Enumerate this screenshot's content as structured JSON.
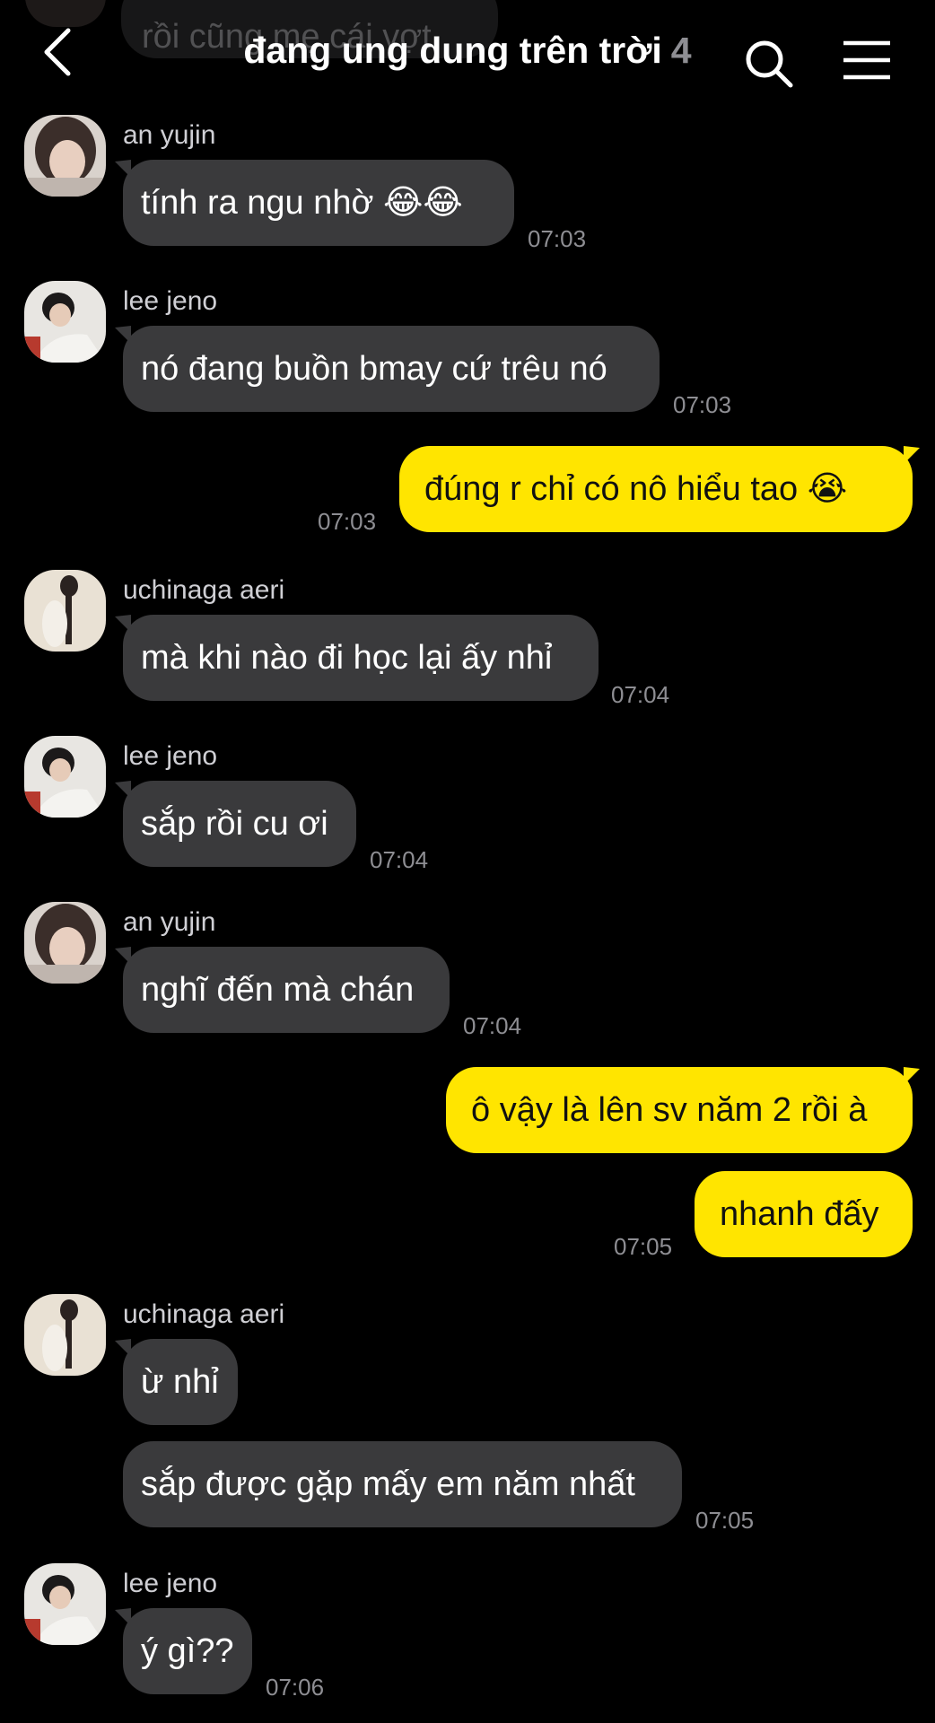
{
  "header": {
    "partial_message": "rồi cũng mẹ cái vợt",
    "title": "đang ung dung trên trời",
    "member_count": "4"
  },
  "colors": {
    "background": "#000000",
    "incoming_bubble": "#3a3a3c",
    "outgoing_bubble": "#ffe500",
    "timestamp": "#8e8e93"
  },
  "messages": [
    {
      "sender": "an yujin",
      "text": "tính ra ngu nhờ 😂😂",
      "time": "07:03"
    },
    {
      "sender": "lee jeno",
      "text": "nó đang buồn bmay cứ trêu nó",
      "time": "07:03"
    },
    {
      "sender": "",
      "text": "đúng r chỉ có nô hiểu tao 😭",
      "time": "07:03"
    },
    {
      "sender": "uchinaga aeri",
      "text": "mà khi nào đi học lại ấy nhỉ",
      "time": "07:04"
    },
    {
      "sender": "lee jeno",
      "text": "sắp rồi cu ơi",
      "time": "07:04"
    },
    {
      "sender": "an yujin",
      "text": "nghĩ đến mà chán",
      "time": "07:04"
    },
    {
      "sender": "",
      "text": "ô vậy là lên sv năm 2 rồi à",
      "time": ""
    },
    {
      "sender": "",
      "text": "nhanh đấy",
      "time": "07:05"
    },
    {
      "sender": "uchinaga aeri",
      "text": "ừ nhỉ",
      "time": ""
    },
    {
      "sender": "",
      "text": "sắp được gặp mấy em năm nhất",
      "time": "07:05"
    },
    {
      "sender": "lee jeno",
      "text": "ý gì??",
      "time": "07:06"
    }
  ]
}
